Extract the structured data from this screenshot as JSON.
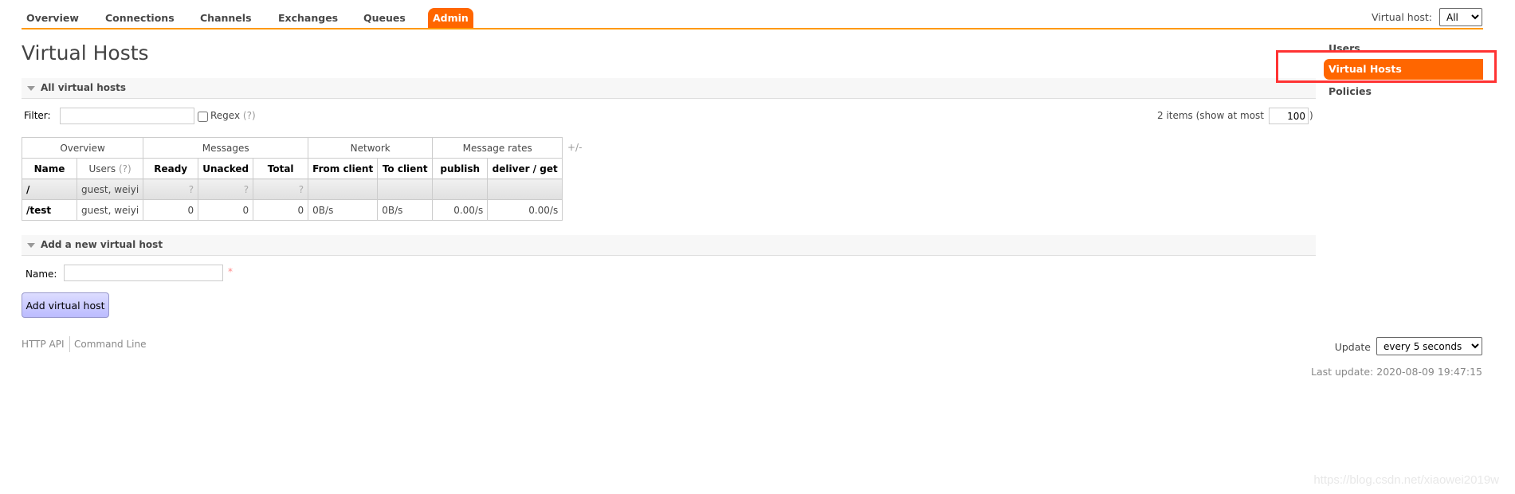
{
  "nav": {
    "tabs": [
      "Overview",
      "Connections",
      "Channels",
      "Exchanges",
      "Queues",
      "Admin"
    ],
    "active": "Admin"
  },
  "vhost_selector": {
    "label": "Virtual host:",
    "value": "All"
  },
  "page_title": "Virtual Hosts",
  "all_section": {
    "title": "All virtual hosts",
    "filter_label": "Filter:",
    "filter_value": "",
    "regex_label": "Regex",
    "regex_hint": "(?)",
    "items_text": "2 items (show at most",
    "max_value": "100",
    "items_close": ")",
    "toggle_columns": "+/-"
  },
  "table": {
    "groups": [
      "Overview",
      "Messages",
      "Network",
      "Message rates"
    ],
    "columns": [
      "Name",
      "Users",
      "Ready",
      "Unacked",
      "Total",
      "From client",
      "To client",
      "publish",
      "deliver / get"
    ],
    "users_hint": "(?)",
    "rows": [
      {
        "name": "/",
        "users": "guest, weiyi",
        "ready": "?",
        "unacked": "?",
        "total": "?",
        "from_client": "",
        "to_client": "",
        "publish": "",
        "deliver_get": ""
      },
      {
        "name": "/test",
        "users": "guest, weiyi",
        "ready": "0",
        "unacked": "0",
        "total": "0",
        "from_client": "0B/s",
        "to_client": "0B/s",
        "publish": "0.00/s",
        "deliver_get": "0.00/s"
      }
    ]
  },
  "add_section": {
    "title": "Add a new virtual host",
    "name_label": "Name:",
    "name_value": "",
    "required_mark": "*",
    "button": "Add virtual host"
  },
  "footer": {
    "links": [
      "HTTP API",
      "Command Line"
    ],
    "update_label": "Update",
    "update_value": "every 5 seconds",
    "last_update": "Last update: 2020-08-09 19:47:15"
  },
  "sidebar": {
    "items": [
      "Users",
      "Virtual Hosts",
      "Policies"
    ],
    "active": "Virtual Hosts"
  },
  "watermark": "https://blog.csdn.net/xiaowei2019w",
  "colors": {
    "accent": "#ff6600",
    "nav_line": "#ff9900",
    "highlight_box": "#ff3333",
    "button": "#bbbbff"
  }
}
